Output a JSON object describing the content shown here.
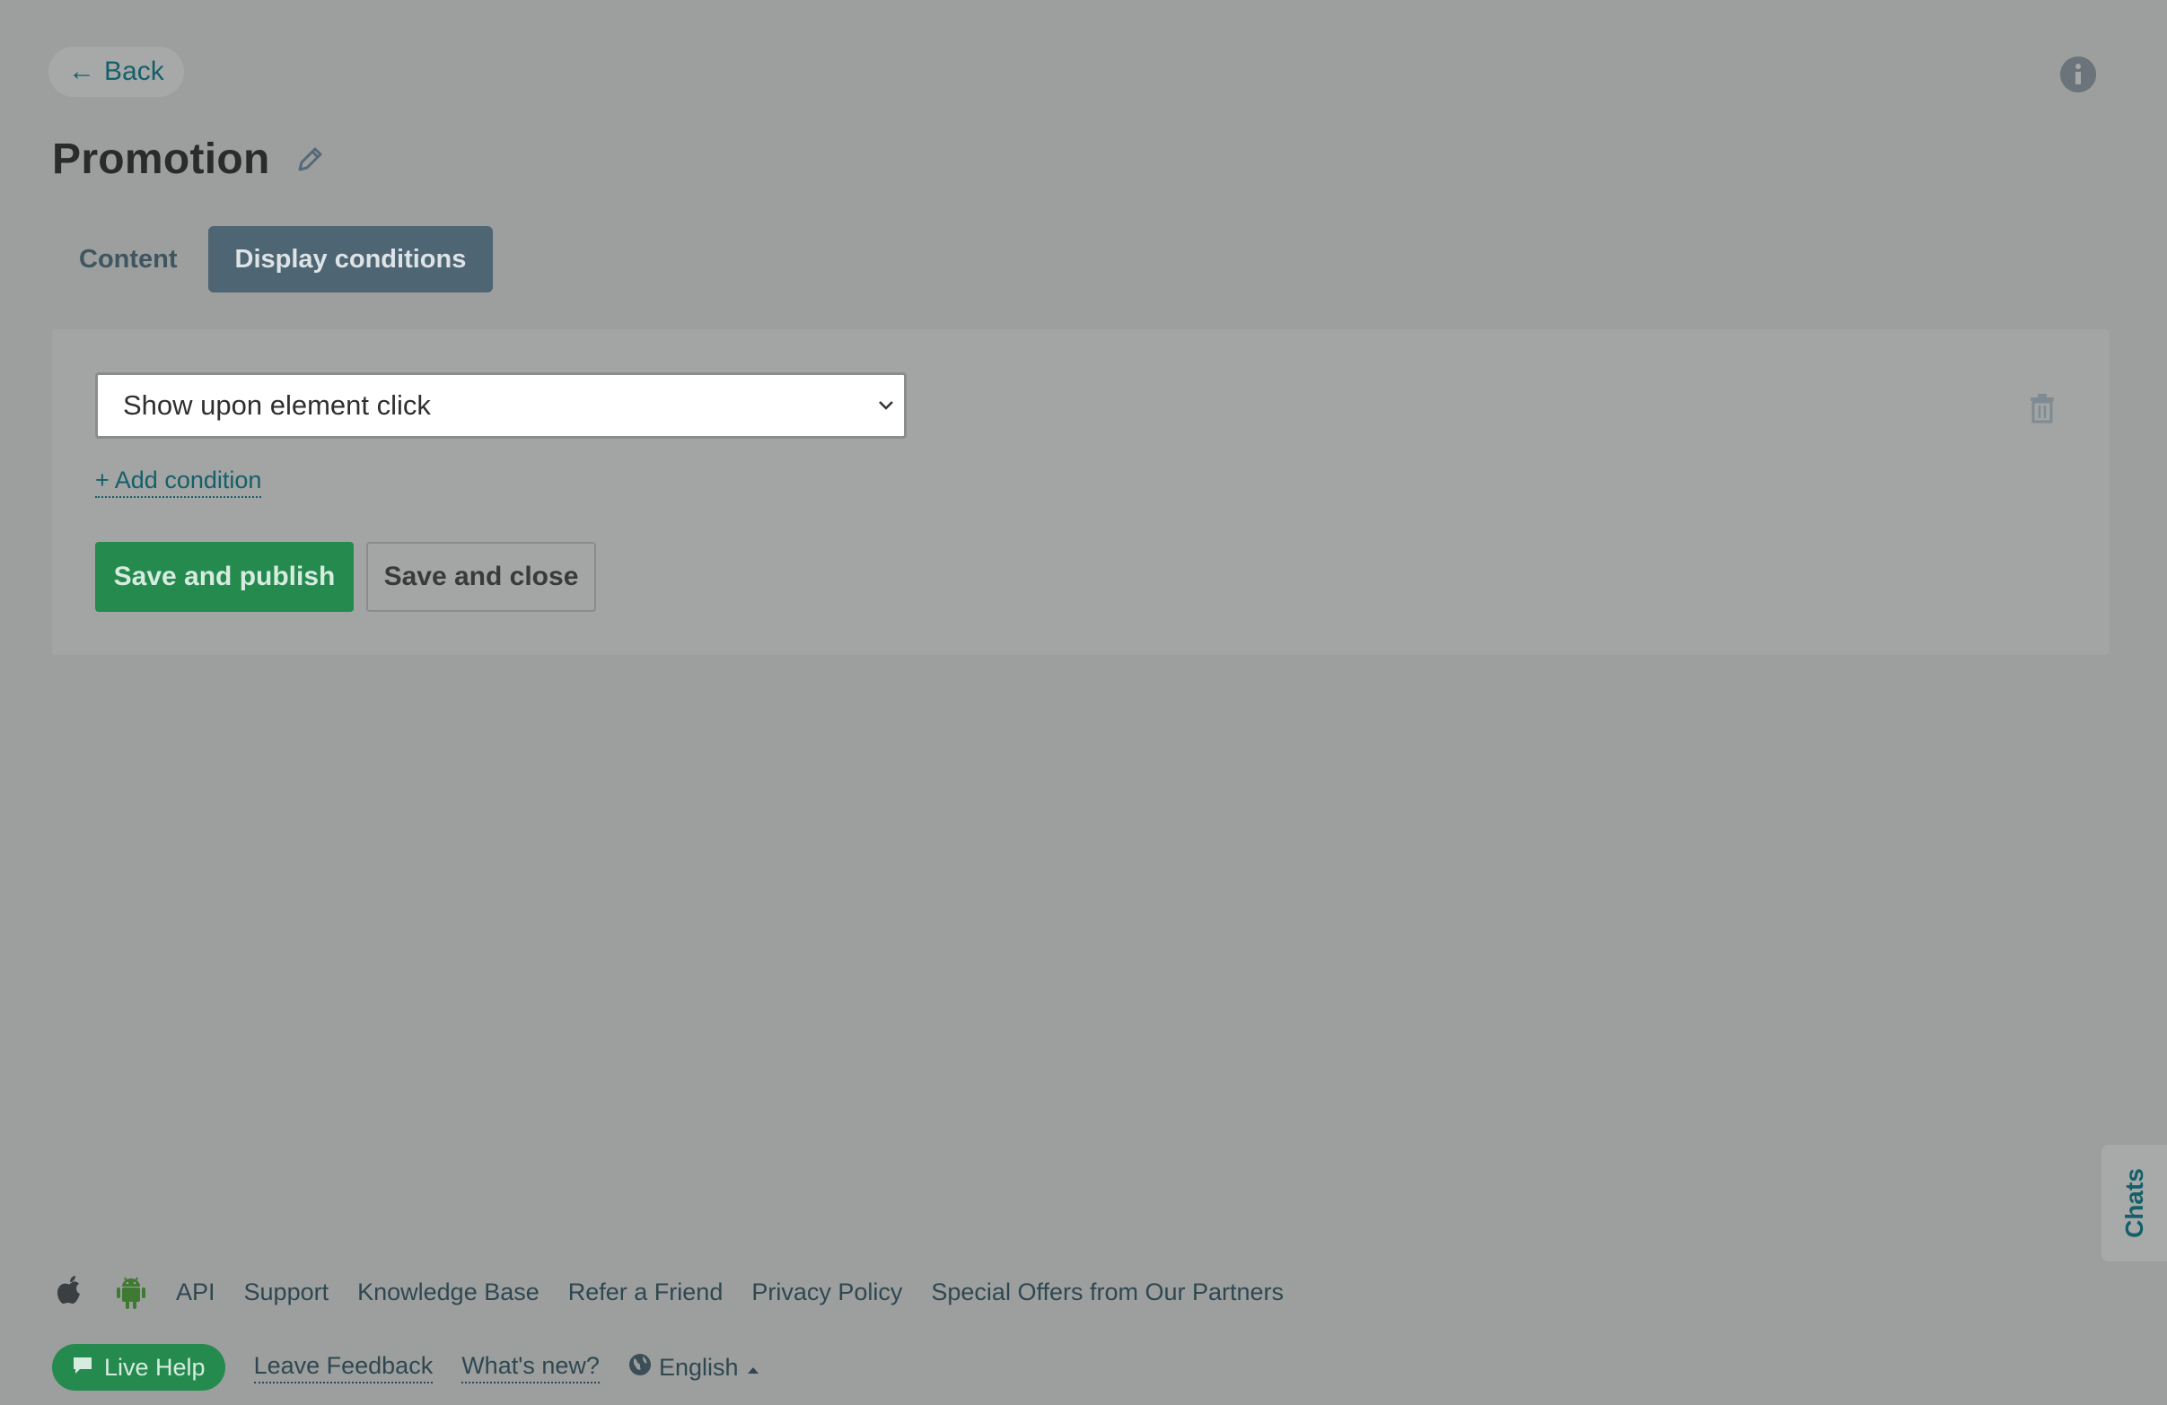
{
  "header": {
    "back_label": "Back",
    "back_arrow": "←",
    "title": "Promotion"
  },
  "tabs": [
    {
      "label": "Content",
      "active": false
    },
    {
      "label": "Display conditions",
      "active": true
    }
  ],
  "panel": {
    "condition_select_value": "Show upon element click",
    "add_condition_label": "+ Add condition",
    "save_publish_label": "Save and publish",
    "save_close_label": "Save and close"
  },
  "side": {
    "chats_label": "Chats"
  },
  "footer": {
    "links": [
      "API",
      "Support",
      "Knowledge Base",
      "Refer a Friend",
      "Privacy Policy",
      "Special Offers from Our Partners"
    ],
    "live_help_label": "Live Help",
    "leave_feedback_label": "Leave Feedback",
    "whats_new_label": "What's new?",
    "language_label": "English"
  },
  "colors": {
    "accent_teal": "#13606a",
    "primary_green": "#258a4e",
    "active_tab": "#4e6573",
    "background": "#9c9f9d"
  },
  "icons": [
    "info-icon",
    "edit-icon",
    "chevron-down-icon",
    "trash-icon",
    "apple-icon",
    "android-icon",
    "chat-bubble-icon",
    "globe-icon",
    "caret-up-icon"
  ]
}
